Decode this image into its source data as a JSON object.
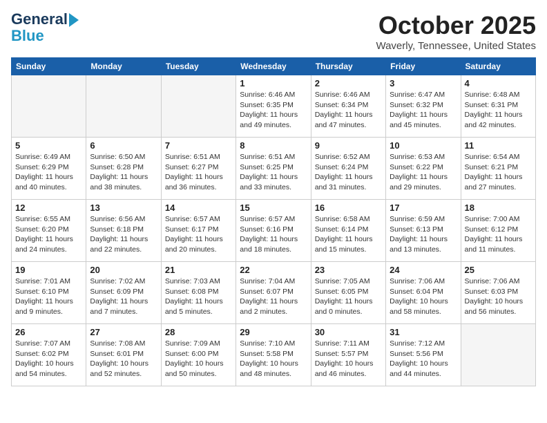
{
  "logo": {
    "line1": "General",
    "line2": "Blue"
  },
  "title": "October 2025",
  "location": "Waverly, Tennessee, United States",
  "days_of_week": [
    "Sunday",
    "Monday",
    "Tuesday",
    "Wednesday",
    "Thursday",
    "Friday",
    "Saturday"
  ],
  "weeks": [
    [
      {
        "day": "",
        "empty": true
      },
      {
        "day": "",
        "empty": true
      },
      {
        "day": "",
        "empty": true
      },
      {
        "day": "1",
        "sunrise": "6:46 AM",
        "sunset": "6:35 PM",
        "daylight": "11 hours and 49 minutes."
      },
      {
        "day": "2",
        "sunrise": "6:46 AM",
        "sunset": "6:34 PM",
        "daylight": "11 hours and 47 minutes."
      },
      {
        "day": "3",
        "sunrise": "6:47 AM",
        "sunset": "6:32 PM",
        "daylight": "11 hours and 45 minutes."
      },
      {
        "day": "4",
        "sunrise": "6:48 AM",
        "sunset": "6:31 PM",
        "daylight": "11 hours and 42 minutes."
      }
    ],
    [
      {
        "day": "5",
        "sunrise": "6:49 AM",
        "sunset": "6:29 PM",
        "daylight": "11 hours and 40 minutes."
      },
      {
        "day": "6",
        "sunrise": "6:50 AM",
        "sunset": "6:28 PM",
        "daylight": "11 hours and 38 minutes."
      },
      {
        "day": "7",
        "sunrise": "6:51 AM",
        "sunset": "6:27 PM",
        "daylight": "11 hours and 36 minutes."
      },
      {
        "day": "8",
        "sunrise": "6:51 AM",
        "sunset": "6:25 PM",
        "daylight": "11 hours and 33 minutes."
      },
      {
        "day": "9",
        "sunrise": "6:52 AM",
        "sunset": "6:24 PM",
        "daylight": "11 hours and 31 minutes."
      },
      {
        "day": "10",
        "sunrise": "6:53 AM",
        "sunset": "6:22 PM",
        "daylight": "11 hours and 29 minutes."
      },
      {
        "day": "11",
        "sunrise": "6:54 AM",
        "sunset": "6:21 PM",
        "daylight": "11 hours and 27 minutes."
      }
    ],
    [
      {
        "day": "12",
        "sunrise": "6:55 AM",
        "sunset": "6:20 PM",
        "daylight": "11 hours and 24 minutes."
      },
      {
        "day": "13",
        "sunrise": "6:56 AM",
        "sunset": "6:18 PM",
        "daylight": "11 hours and 22 minutes."
      },
      {
        "day": "14",
        "sunrise": "6:57 AM",
        "sunset": "6:17 PM",
        "daylight": "11 hours and 20 minutes."
      },
      {
        "day": "15",
        "sunrise": "6:57 AM",
        "sunset": "6:16 PM",
        "daylight": "11 hours and 18 minutes."
      },
      {
        "day": "16",
        "sunrise": "6:58 AM",
        "sunset": "6:14 PM",
        "daylight": "11 hours and 15 minutes."
      },
      {
        "day": "17",
        "sunrise": "6:59 AM",
        "sunset": "6:13 PM",
        "daylight": "11 hours and 13 minutes."
      },
      {
        "day": "18",
        "sunrise": "7:00 AM",
        "sunset": "6:12 PM",
        "daylight": "11 hours and 11 minutes."
      }
    ],
    [
      {
        "day": "19",
        "sunrise": "7:01 AM",
        "sunset": "6:10 PM",
        "daylight": "11 hours and 9 minutes."
      },
      {
        "day": "20",
        "sunrise": "7:02 AM",
        "sunset": "6:09 PM",
        "daylight": "11 hours and 7 minutes."
      },
      {
        "day": "21",
        "sunrise": "7:03 AM",
        "sunset": "6:08 PM",
        "daylight": "11 hours and 5 minutes."
      },
      {
        "day": "22",
        "sunrise": "7:04 AM",
        "sunset": "6:07 PM",
        "daylight": "11 hours and 2 minutes."
      },
      {
        "day": "23",
        "sunrise": "7:05 AM",
        "sunset": "6:05 PM",
        "daylight": "11 hours and 0 minutes."
      },
      {
        "day": "24",
        "sunrise": "7:06 AM",
        "sunset": "6:04 PM",
        "daylight": "10 hours and 58 minutes."
      },
      {
        "day": "25",
        "sunrise": "7:06 AM",
        "sunset": "6:03 PM",
        "daylight": "10 hours and 56 minutes."
      }
    ],
    [
      {
        "day": "26",
        "sunrise": "7:07 AM",
        "sunset": "6:02 PM",
        "daylight": "10 hours and 54 minutes."
      },
      {
        "day": "27",
        "sunrise": "7:08 AM",
        "sunset": "6:01 PM",
        "daylight": "10 hours and 52 minutes."
      },
      {
        "day": "28",
        "sunrise": "7:09 AM",
        "sunset": "6:00 PM",
        "daylight": "10 hours and 50 minutes."
      },
      {
        "day": "29",
        "sunrise": "7:10 AM",
        "sunset": "5:58 PM",
        "daylight": "10 hours and 48 minutes."
      },
      {
        "day": "30",
        "sunrise": "7:11 AM",
        "sunset": "5:57 PM",
        "daylight": "10 hours and 46 minutes."
      },
      {
        "day": "31",
        "sunrise": "7:12 AM",
        "sunset": "5:56 PM",
        "daylight": "10 hours and 44 minutes."
      },
      {
        "day": "",
        "empty": true
      }
    ]
  ]
}
